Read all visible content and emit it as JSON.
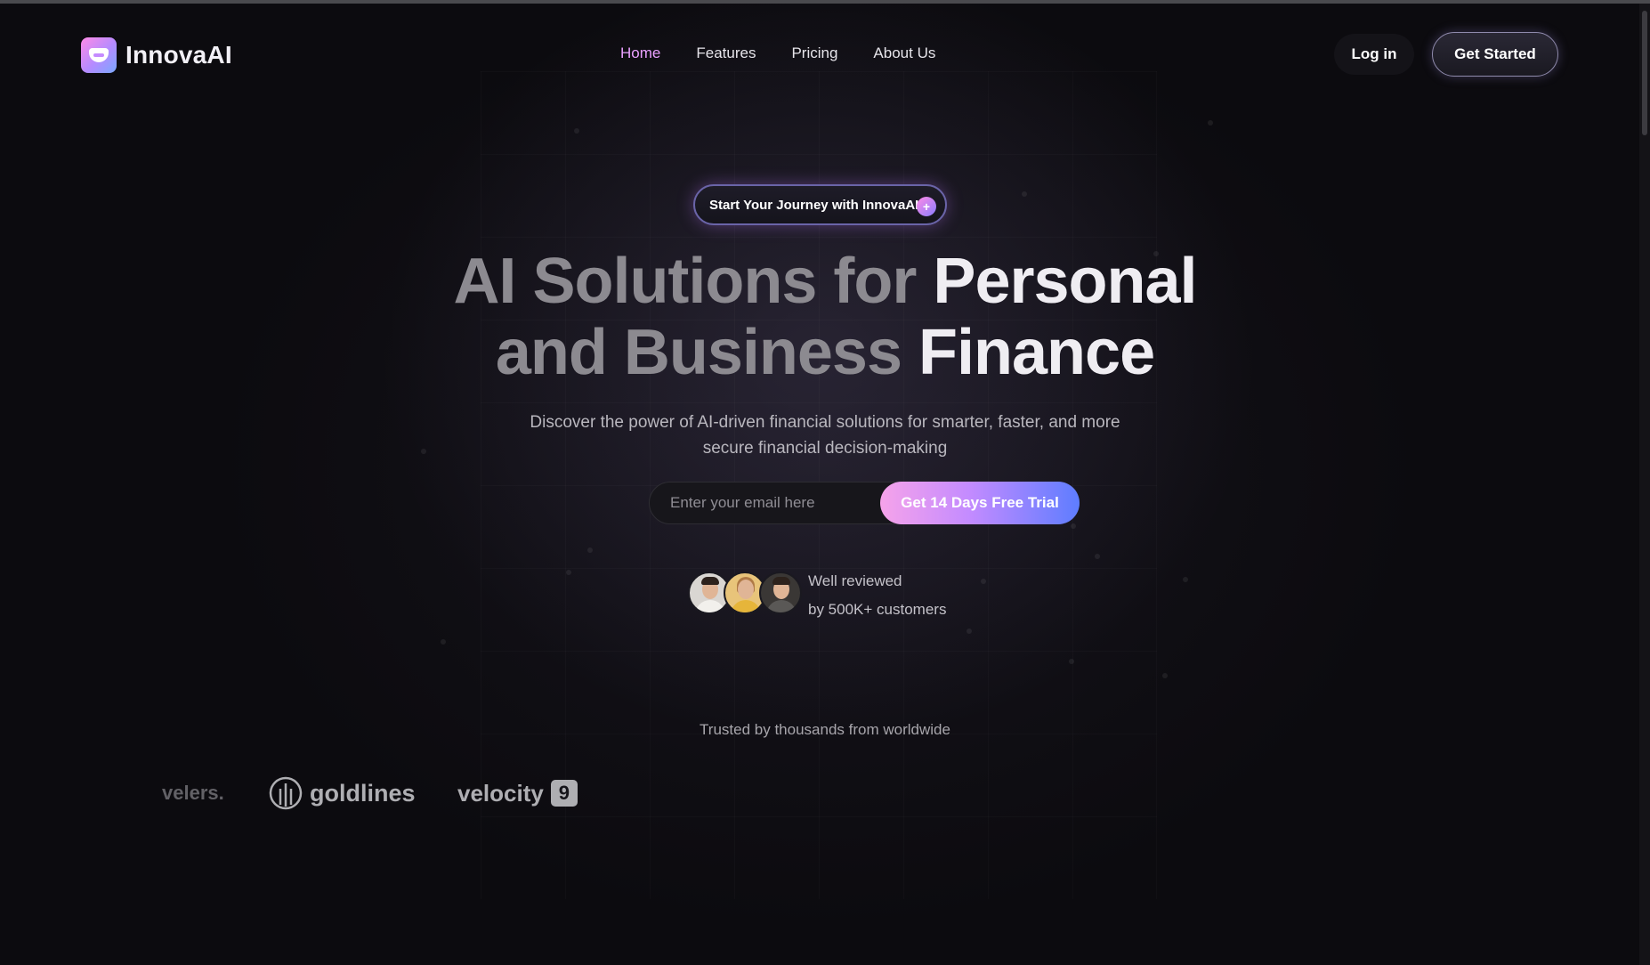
{
  "brand": {
    "name": "InnovaAI"
  },
  "nav": {
    "items": [
      {
        "label": "Home",
        "active": true
      },
      {
        "label": "Features",
        "active": false
      },
      {
        "label": "Pricing",
        "active": false
      },
      {
        "label": "About Us",
        "active": false
      }
    ],
    "login_label": "Log in",
    "cta_label": "Get Started"
  },
  "hero": {
    "badge_label": "Start Your Journey with InnovaAI",
    "badge_icon": "plus-icon",
    "headline": {
      "line1_dim": "AI Solutions for",
      "line1_bright": "Personal",
      "line2_dim": "and Business",
      "line2_bright": "Finance"
    },
    "subtitle": "Discover the power of AI-driven financial solutions for smarter, faster, and more secure financial decision-making",
    "email_placeholder": "Enter your email here",
    "trial_button": "Get 14 Days Free Trial",
    "review_line1": "Well reviewed",
    "review_line2": "by 500K+ customers"
  },
  "trusted": {
    "label": "Trusted by thousands from worldwide",
    "brands": [
      {
        "name": "velers."
      },
      {
        "name": "goldlines"
      },
      {
        "name": "velocity",
        "badge": "9"
      }
    ]
  },
  "colors": {
    "accent": "#e9a0ff",
    "background": "#0c0b0f",
    "cta_gradient_start": "#f6a3ea",
    "cta_gradient_end": "#5e7dff"
  }
}
